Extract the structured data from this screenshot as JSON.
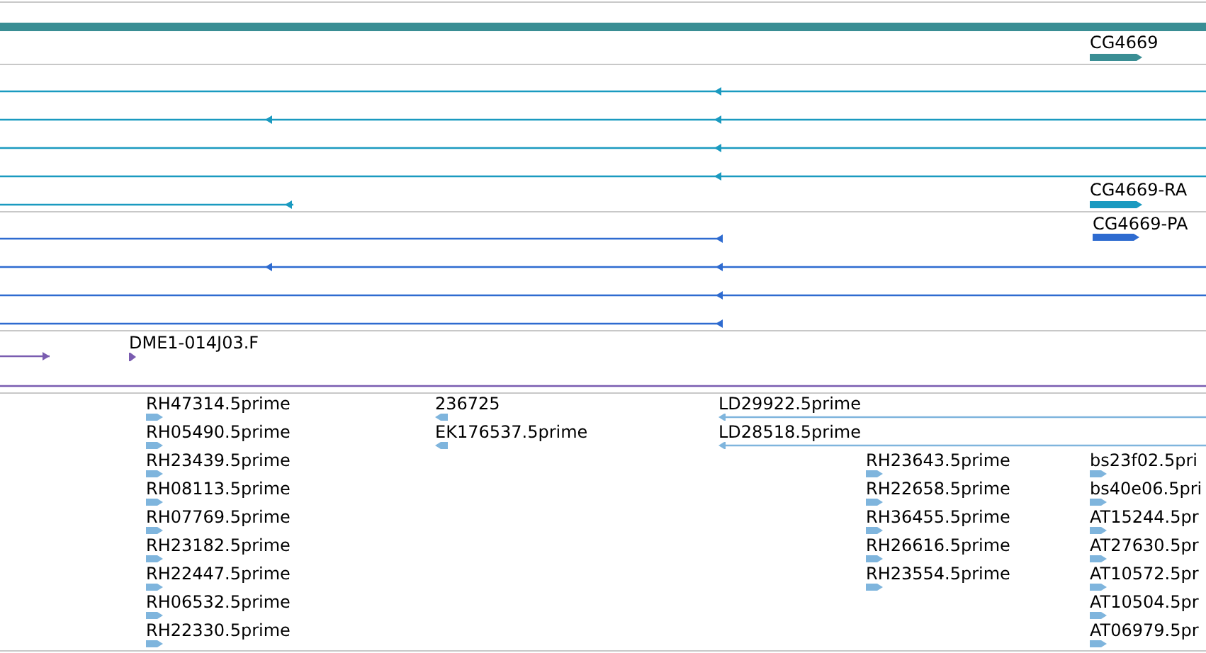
{
  "gene_track": {
    "features": [
      {
        "label": "CG4669",
        "reverse": false
      }
    ]
  },
  "transcript_track": {
    "features": [
      {
        "reverse": true
      },
      {
        "reverse": true
      },
      {
        "reverse": true
      },
      {
        "reverse": true
      },
      {
        "reverse": true
      },
      {
        "label": "CG4669-RA",
        "reverse": false
      }
    ]
  },
  "protein_track": {
    "features": [
      {
        "label": "CG4669-PA",
        "reverse": false
      },
      {
        "reverse": true
      },
      {
        "reverse": true
      },
      {
        "reverse": true
      },
      {
        "reverse": true
      }
    ]
  },
  "clone_track": {
    "features": [
      {
        "reverse": false
      },
      {
        "label": "DME1-014J03.F",
        "reverse": false
      }
    ]
  },
  "est_track": {
    "columns": [
      {
        "features": [
          {
            "label": "RH47314.5prime",
            "reverse": false
          },
          {
            "label": "RH05490.5prime",
            "reverse": false
          },
          {
            "label": "RH23439.5prime",
            "reverse": false
          },
          {
            "label": "RH08113.5prime",
            "reverse": false
          },
          {
            "label": "RH07769.5prime",
            "reverse": false
          },
          {
            "label": "RH23182.5prime",
            "reverse": false
          },
          {
            "label": "RH22447.5prime",
            "reverse": false
          },
          {
            "label": "RH06532.5prime",
            "reverse": false
          },
          {
            "label": "RH22330.5prime",
            "reverse": false
          }
        ]
      },
      {
        "features": [
          {
            "label": "236725",
            "reverse": true
          },
          {
            "label": "EK176537.5prime",
            "reverse": true
          }
        ]
      },
      {
        "features": [
          {
            "label": "LD29922.5prime",
            "reverse": true
          },
          {
            "label": "LD28518.5prime",
            "reverse": true
          }
        ]
      },
      {
        "features": [
          {
            "label": "RH23643.5prime",
            "reverse": false
          },
          {
            "label": "RH22658.5prime",
            "reverse": false
          },
          {
            "label": "RH36455.5prime",
            "reverse": false
          },
          {
            "label": "RH26616.5prime",
            "reverse": false
          },
          {
            "label": "RH23554.5prime",
            "reverse": false
          }
        ]
      },
      {
        "features": [
          {
            "label": "bs23f02.5pri",
            "reverse": false
          },
          {
            "label": "bs40e06.5pri",
            "reverse": false
          },
          {
            "label": "AT15244.5pr",
            "reverse": false
          },
          {
            "label": "AT27630.5pr",
            "reverse": false
          },
          {
            "label": "AT10572.5pr",
            "reverse": false
          },
          {
            "label": "AT10504.5pr",
            "reverse": false
          },
          {
            "label": "AT06979.5pr",
            "reverse": false
          }
        ]
      }
    ]
  }
}
